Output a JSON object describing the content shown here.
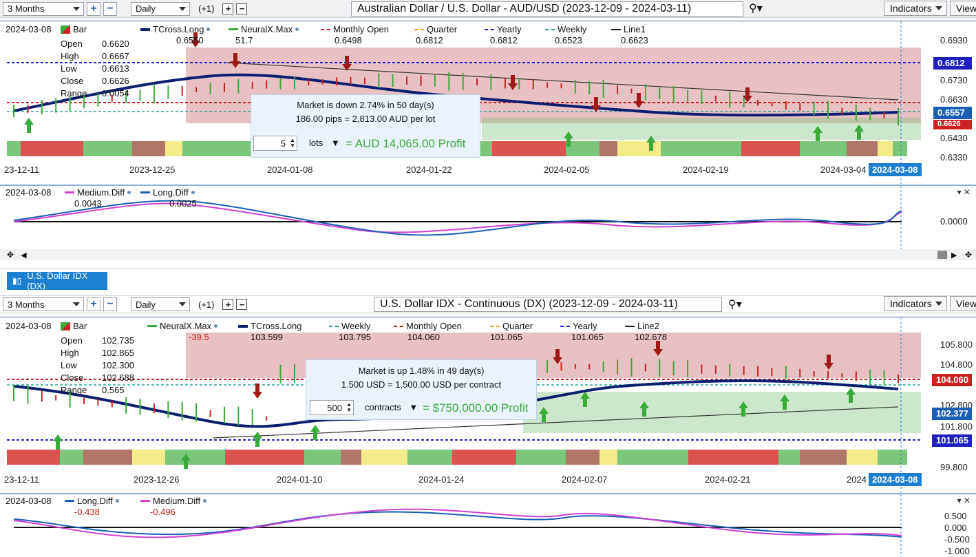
{
  "top": {
    "toolbar": {
      "period": "3 Months",
      "interval": "Daily",
      "plus_one": "(+1)",
      "title": "Australian Dollar / U.S. Dollar - AUD/USD (2023-12-09 - 2024-03-11)",
      "indicators": "Indicators",
      "view": "View"
    },
    "legend": {
      "date": "2024-03-08",
      "bar": "Bar",
      "tcross": "TCross.Long",
      "tcross_val": "0.6550",
      "neural": "NeuralX.Max",
      "neural_val": "51.7",
      "monthly": "Monthly Open",
      "monthly_val": "0.6498",
      "quarter": "Quarter",
      "quarter_val": "0.6812",
      "yearly": "Yearly",
      "yearly_val": "0.6812",
      "weekly": "Weekly",
      "weekly_val": "0.6523",
      "line1": "Line1",
      "line1_val": "0.6623"
    },
    "ohlc": {
      "open_k": "Open",
      "open": "0.6620",
      "high_k": "High",
      "high": "0.6667",
      "low_k": "Low",
      "low": "0.6613",
      "close_k": "Close",
      "close": "0.6626",
      "range_k": "Range",
      "range": "0.0054"
    },
    "price_axis": [
      "0.6930",
      "0.6730",
      "0.6630",
      "0.6430",
      "0.6330"
    ],
    "tag_yearly": "0.6812",
    "tag_tcross": "0.6557",
    "tag_close": "0.6626",
    "date_axis": [
      "23-12-11",
      "2023-12-25",
      "2024-01-08",
      "2024-01-22",
      "2024-02-05",
      "2024-02-19",
      "2024-03-04"
    ],
    "date_badge": "2024-03-08",
    "popup": {
      "line1": "Market is down 2.74% in 50 day(s)",
      "line2": "186.00 pips = 2,813.00 AUD per lot",
      "qty": "5",
      "unit": "lots",
      "profit": "= AUD 14,065.00 Profit"
    },
    "sub": {
      "date": "2024-03-08",
      "medium": "Medium.Diff",
      "medium_val": "0.0043",
      "long": "Long.Diff",
      "long_val": "0.0025",
      "axis": "0.0000"
    }
  },
  "dx_tab": "U.S. Dollar IDX (DX)",
  "bottom": {
    "toolbar": {
      "period": "3 Months",
      "interval": "Daily",
      "plus_one": "(+1)",
      "title": "U.S. Dollar IDX - Continuous (DX) (2023-12-09 - 2024-03-11)",
      "indicators": "Indicators",
      "view": "View"
    },
    "legend": {
      "date": "2024-03-08",
      "bar": "Bar",
      "neural": "NeuralX.Max",
      "neural_val": "-39.5",
      "tcross": "TCross.Long",
      "tcross_val": "103.599",
      "weekly": "Weekly",
      "weekly_val": "103.795",
      "monthly": "Monthly Open",
      "monthly_val": "104.060",
      "quarter": "Quarter",
      "quarter_val": "101.065",
      "yearly": "Yearly",
      "yearly_val": "101.065",
      "line2": "Line2",
      "line2_val": "102.678"
    },
    "ohlc": {
      "open_k": "Open",
      "open": "102.735",
      "high_k": "High",
      "high": "102.865",
      "low_k": "Low",
      "low": "102.300",
      "close_k": "Close",
      "close": "102.688",
      "range_k": "Range",
      "range": "0.565"
    },
    "price_axis": [
      "105.800",
      "104.800",
      "102.800",
      "101.800",
      "99.800"
    ],
    "tag_monthly": "104.060",
    "tag_close": "102.377",
    "tag_yearly": "101.065",
    "date_axis": [
      "23-12-11",
      "2023-12-26",
      "2024-01-10",
      "2024-01-24",
      "2024-02-07",
      "2024-02-21",
      "2024"
    ],
    "date_badge": "2024-03-08",
    "popup": {
      "line1": "Market is up 1.48% in 49 day(s)",
      "line2": "1.500 USD = 1,500.00 USD per contract",
      "qty": "500",
      "unit": "contracts",
      "profit": "= $750,000.00 Profit"
    },
    "sub": {
      "date": "2024-03-08",
      "long": "Long.Diff",
      "long_val": "-0.438",
      "medium": "Medium.Diff",
      "medium_val": "-0.496",
      "axis": [
        "0.500",
        "0.000",
        "-0.500",
        "-1.000"
      ]
    }
  },
  "colors": {
    "tcross": "#0b1f6e",
    "neural": "#3aaa3a",
    "monthly": "#cc2222",
    "quarter": "#f0a020",
    "yearly": "#2222cc",
    "weekly": "#2aa39a",
    "line": "#222222",
    "medium": "#d040d0",
    "long": "#1a5fb4",
    "accent": "#1d7fd0"
  }
}
